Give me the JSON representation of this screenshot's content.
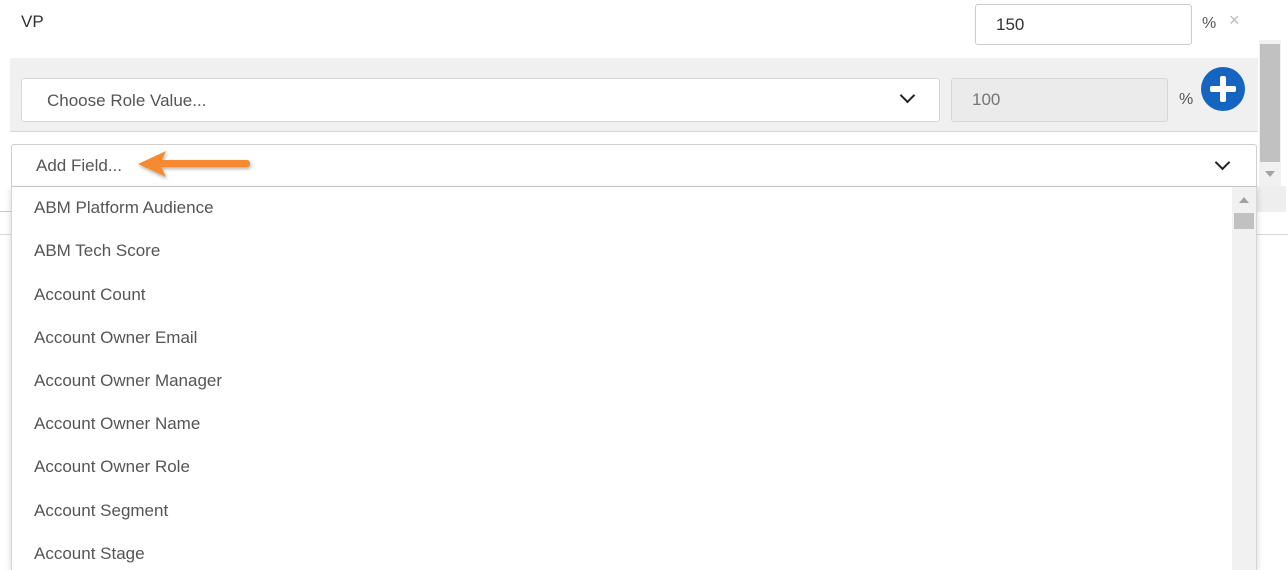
{
  "vp_row": {
    "label": "VP",
    "value": "150",
    "percent_sign": "%",
    "close_symbol": "×"
  },
  "role_row": {
    "select_placeholder": "Choose Role Value...",
    "value_placeholder": "100",
    "percent_sign": "%",
    "add_icon": "plus-circle-icon",
    "add_color": "#1565c0"
  },
  "field_select": {
    "placeholder": "Add Field...",
    "annotation_color": "#f58a33"
  },
  "dropdown": {
    "options": [
      "ABM Platform Audience",
      "ABM Tech Score",
      "Account Count",
      "Account Owner Email",
      "Account Owner Manager",
      "Account Owner Name",
      "Account Owner Role",
      "Account Segment",
      "Account Stage"
    ]
  }
}
